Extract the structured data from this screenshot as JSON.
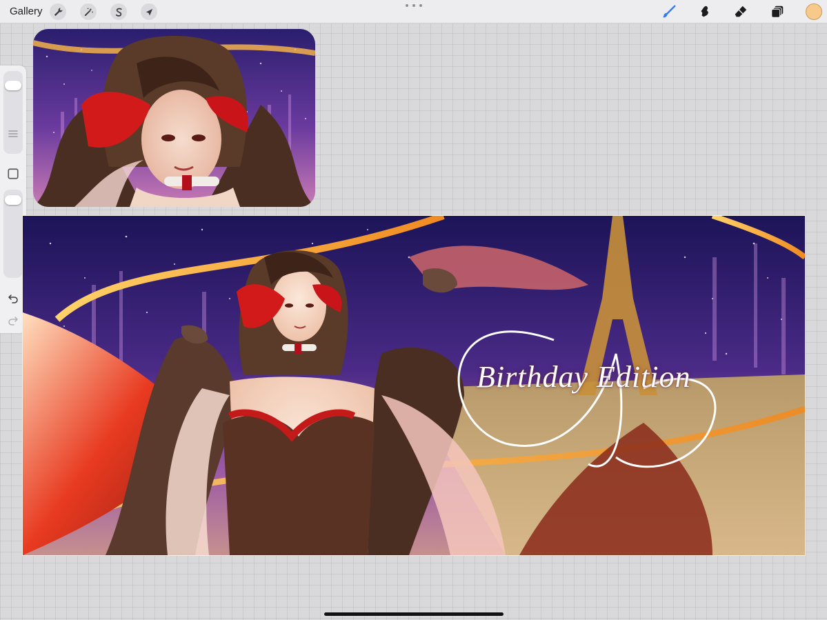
{
  "topbar": {
    "gallery_label": "Gallery",
    "left_tools": [
      {
        "name": "actions",
        "icon": "wrench-icon"
      },
      {
        "name": "adjustments",
        "icon": "magic-wand-icon"
      },
      {
        "name": "selection",
        "icon": "selection-s-icon"
      },
      {
        "name": "transform",
        "icon": "arrow-cursor-icon"
      }
    ],
    "right_tools": [
      {
        "name": "brush",
        "icon": "brush-icon",
        "active": true
      },
      {
        "name": "smudge",
        "icon": "smudge-icon"
      },
      {
        "name": "eraser",
        "icon": "eraser-icon"
      },
      {
        "name": "layers",
        "icon": "layers-icon"
      }
    ],
    "active_color": "#f7c98a",
    "accent_color": "#2f7cf6"
  },
  "sidebar": {
    "brush_size_level": 0.12,
    "opacity_level": 0.05,
    "icons": [
      "menu-lines-icon",
      "square-modify-icon",
      "undo-icon",
      "redo-icon"
    ]
  },
  "canvas": {
    "title_text": "Birthday Edition",
    "background_color": "#d9d9db"
  }
}
